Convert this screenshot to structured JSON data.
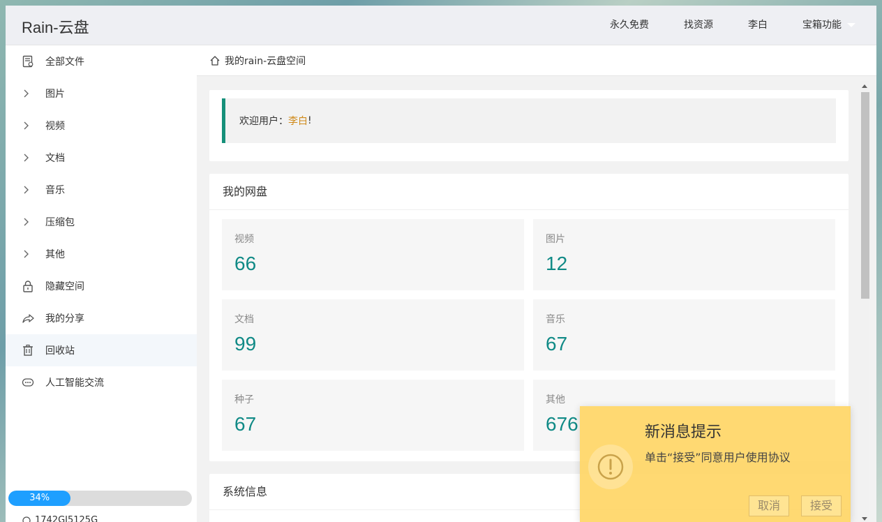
{
  "header": {
    "brand": "Rain-云盘",
    "nav": [
      "永久免费",
      "找资源",
      "李白",
      "宝箱功能"
    ]
  },
  "sidebar": {
    "items": [
      {
        "label": "全部文件",
        "icon": "file-icon"
      },
      {
        "label": "图片",
        "icon": "chevron-right-icon"
      },
      {
        "label": "视频",
        "icon": "chevron-right-icon"
      },
      {
        "label": "文档",
        "icon": "chevron-right-icon"
      },
      {
        "label": "音乐",
        "icon": "chevron-right-icon"
      },
      {
        "label": "压缩包",
        "icon": "chevron-right-icon"
      },
      {
        "label": "其他",
        "icon": "chevron-right-icon"
      },
      {
        "label": "隐藏空间",
        "icon": "lock-icon"
      },
      {
        "label": "我的分享",
        "icon": "share-icon"
      },
      {
        "label": "回收站",
        "icon": "trash-icon"
      },
      {
        "label": "人工智能交流",
        "icon": "chat-icon"
      }
    ],
    "progress": {
      "label": "34%",
      "value": 34
    },
    "storage": "1742GI5125G"
  },
  "breadcrumb": "我的rain-云盘空间",
  "welcome": {
    "prefix": "欢迎用户：",
    "user": "李白",
    "suffix": "!"
  },
  "disk": {
    "title": "我的网盘",
    "stats": [
      {
        "label": "视频",
        "value": "66"
      },
      {
        "label": "图片",
        "value": "12"
      },
      {
        "label": "文档",
        "value": "99"
      },
      {
        "label": "音乐",
        "value": "67"
      },
      {
        "label": "种子",
        "value": "67"
      },
      {
        "label": "其他",
        "value": "676"
      }
    ]
  },
  "system": {
    "title": "系统信息"
  },
  "toast": {
    "title": "新消息提示",
    "message": "单击“接受”同意用户使用协议",
    "cancel": "取消",
    "accept": "接受"
  },
  "colors": {
    "accent": "#16907a",
    "stat_value": "#108a86",
    "progress": "#1e9fff",
    "toast_bg": "#ffd666"
  }
}
